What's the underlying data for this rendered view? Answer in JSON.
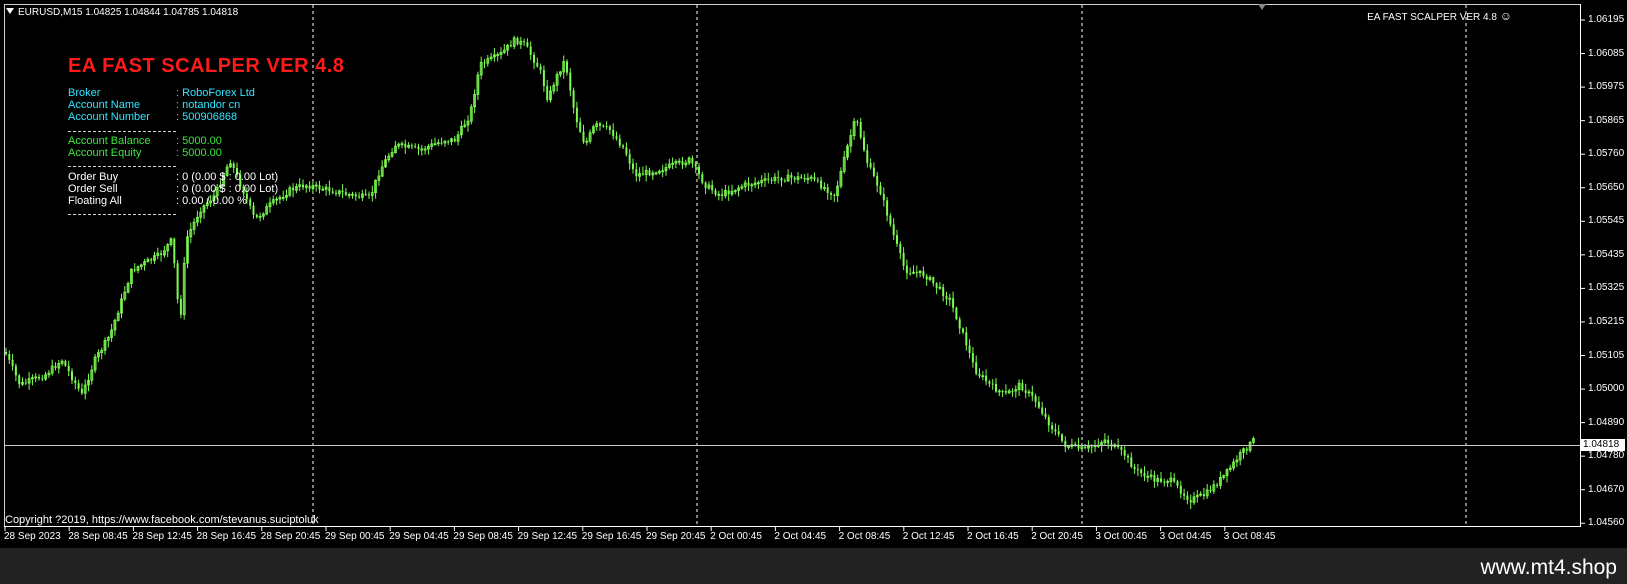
{
  "window": {
    "symbol_line": "EURUSD,M15  1.04825 1.04844 1.04785 1.04818",
    "ea_name": "EA FAST SCALPER VER 4.8",
    "copyright": "Copyright ?2019, https://www.facebook.com/stevanus.suciptoluk"
  },
  "info_panel": {
    "title": "EA FAST SCALPER VER 4.8",
    "rows": [
      {
        "label": "Broker",
        "value": ": RoboForex Ltd",
        "color": "#33e5ff"
      },
      {
        "label": "Account Name",
        "value": ": notandor cn",
        "color": "#33e5ff"
      },
      {
        "label": "Account Number",
        "value": ": 500906868",
        "color": "#33e5ff"
      },
      {
        "label": "Account Balance",
        "value": ": 5000.00",
        "color": "#3ce63c"
      },
      {
        "label": "Account Equity",
        "value": ": 5000.00",
        "color": "#3ce63c"
      },
      {
        "label": "Order Buy",
        "value": ": 0 (0.00 $ : 0.00 Lot)",
        "color": "#ffffff"
      },
      {
        "label": "Order Sell",
        "value": ": 0 (0.00 $ : 0.00 Lot)",
        "color": "#ffffff"
      },
      {
        "label": "Floating All",
        "value": ": 0.00 / 0.00 %",
        "color": "#ffffff"
      }
    ]
  },
  "price_axis": [
    "1.06195",
    "1.06085",
    "1.05975",
    "1.05865",
    "1.05760",
    "1.05650",
    "1.05545",
    "1.05435",
    "1.05325",
    "1.05215",
    "1.05105",
    "1.05000",
    "1.04890",
    "1.04780",
    "1.04670",
    "1.04560"
  ],
  "current_price": "1.04818",
  "time_axis": [
    "28 Sep 2023",
    "28 Sep 08:45",
    "28 Sep 12:45",
    "28 Sep 16:45",
    "28 Sep 20:45",
    "29 Sep 00:45",
    "29 Sep 04:45",
    "29 Sep 08:45",
    "29 Sep 12:45",
    "29 Sep 16:45",
    "29 Sep 20:45",
    "2 Oct 00:45",
    "2 Oct 04:45",
    "2 Oct 08:45",
    "2 Oct 12:45",
    "2 Oct 16:45",
    "2 Oct 20:45",
    "3 Oct 00:45",
    "3 Oct 04:45",
    "3 Oct 08:45"
  ],
  "colors": {
    "candle": "#7cfc52",
    "background": "#000000",
    "axis": "#ffffff",
    "title": "#ff1a1a"
  },
  "icons": {
    "smiley": "smiley-face-icon",
    "dropdown": "triangle-down-icon"
  },
  "footer": {
    "site": "www.mt4.shop"
  }
}
